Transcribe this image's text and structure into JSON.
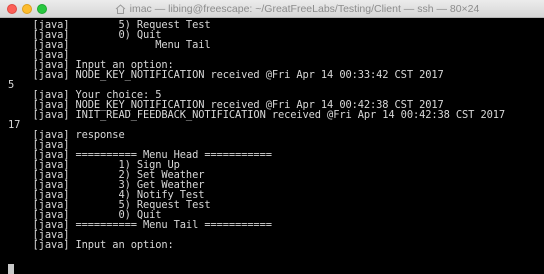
{
  "window": {
    "title": "imac — libing@freescape: ~/GreatFreeLabs/Testing/Client — ssh — 80×24"
  },
  "terminal": {
    "lines": [
      "    [java]        5) Request Test",
      "    [java]        0) Quit",
      "    [java]              Menu Tail",
      "    [java]",
      "    [java] Input an option:",
      "    [java] NODE_KEY_NOTIFICATION received @Fri Apr 14 00:33:42 CST 2017",
      "5",
      "    [java] Your choice: 5",
      "    [java] NODE_KEY_NOTIFICATION received @Fri Apr 14 00:42:38 CST 2017",
      "    [java] INIT_READ_FEEDBACK_NOTIFICATION received @Fri Apr 14 00:42:38 CST 2017",
      "17",
      "    [java] response",
      "    [java]",
      "    [java] ========== Menu Head ===========",
      "    [java]        1) Sign Up",
      "    [java]        2) Set Weather",
      "    [java]        3) Get Weather",
      "    [java]        4) Notify Test",
      "    [java]        5) Request Test",
      "    [java]        0) Quit",
      "    [java] ========== Menu Tail ===========",
      "    [java]",
      "    [java] Input an option:"
    ]
  },
  "icons": {
    "close": "close-button",
    "minimize": "minimize-button",
    "maximize": "zoom-button",
    "title_icon": "home-icon"
  },
  "colors": {
    "background": "#000000",
    "text": "#d8d8d8",
    "titlebar": "#e0e0e0"
  }
}
